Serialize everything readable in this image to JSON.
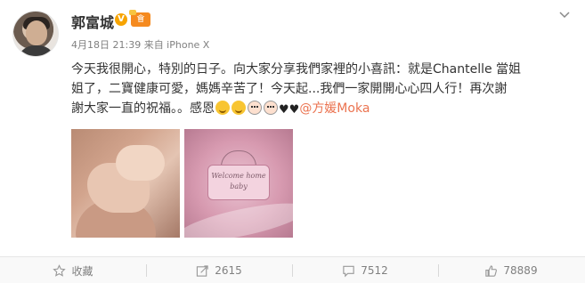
{
  "post": {
    "username": "郭富城",
    "verified_badge": "V",
    "member_badge": "會",
    "meta": "4月18日 21:39 来自 iPhone X",
    "text_line1": "今天我很開心，特別的日子。向大家分享我們家裡的小喜訊：就是Chantelle 當姐",
    "text_line2": "姐了，二寶健康可愛，媽媽辛苦了！今天起...我們一家開開心心四人行！再次謝",
    "text_line3_prefix": "謝大家一直的祝福。。感恩",
    "mention": "@方媛Moka",
    "heart1": "♥",
    "heart2": "♥",
    "image2_caption_line1": "Welcome home",
    "image2_caption_line2": "baby"
  },
  "actions": {
    "favorite": "收藏",
    "repost": "2615",
    "comment": "7512",
    "like": "78889"
  },
  "icons": [
    "avatar",
    "verified-icon",
    "member-icon",
    "chevron-down-icon",
    "star-icon",
    "repost-icon",
    "comment-icon",
    "like-icon",
    "smile-emoji-icon",
    "baby-emoji-icon",
    "heart-icon"
  ],
  "colors": {
    "mention": "#eb7350",
    "meta": "#808080",
    "action_text": "#808080",
    "verified": "#f7a400"
  }
}
